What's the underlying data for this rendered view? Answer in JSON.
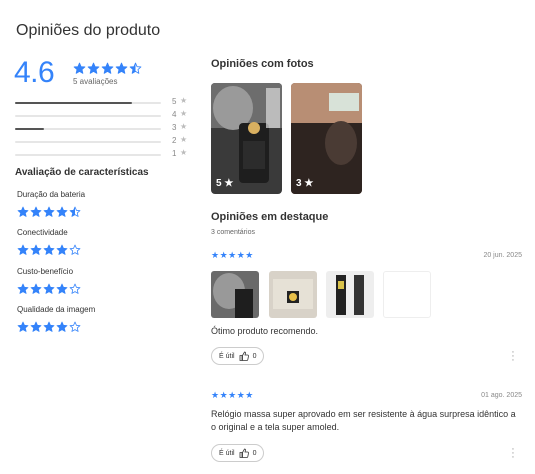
{
  "page_title": "Opiniões do produto",
  "summary": {
    "average": "4.6",
    "count_text": "5 avaliações",
    "stars": [
      1,
      1,
      1,
      1,
      0.5
    ],
    "distribution": [
      {
        "label": "5",
        "fraction": 0.8
      },
      {
        "label": "4",
        "fraction": 0
      },
      {
        "label": "3",
        "fraction": 0.2
      },
      {
        "label": "2",
        "fraction": 0
      },
      {
        "label": "1",
        "fraction": 0
      }
    ]
  },
  "features": {
    "title": "Avaliação de características",
    "items": [
      {
        "label": "Duração da bateria",
        "stars": [
          1,
          1,
          1,
          1,
          0.5
        ]
      },
      {
        "label": "Conectividade",
        "stars": [
          1,
          1,
          1,
          1,
          0
        ]
      },
      {
        "label": "Custo-benefício",
        "stars": [
          1,
          1,
          1,
          1,
          0
        ]
      },
      {
        "label": "Qualidade da imagem",
        "stars": [
          1,
          1,
          1,
          1,
          0
        ]
      }
    ]
  },
  "photos": {
    "title": "Opiniões com fotos",
    "items": [
      {
        "rating": "5 ★"
      },
      {
        "rating": "3 ★"
      }
    ]
  },
  "highlights": {
    "title": "Opiniões em destaque",
    "count_text": "3 comentários",
    "reviews": [
      {
        "stars": "★★★★★",
        "date": "20 jun. 2025",
        "text": "Ótimo produto recomendo.",
        "useful_label": "É útil",
        "useful_count": "0"
      },
      {
        "stars": "★★★★★",
        "date": "01 ago. 2025",
        "text": "Relógio massa super aprovado em ser resistente à água surpresa idêntico a o original e a tela super amoled.",
        "useful_label": "É útil",
        "useful_count": "0"
      }
    ]
  },
  "colors": {
    "accent": "#3483fa"
  }
}
